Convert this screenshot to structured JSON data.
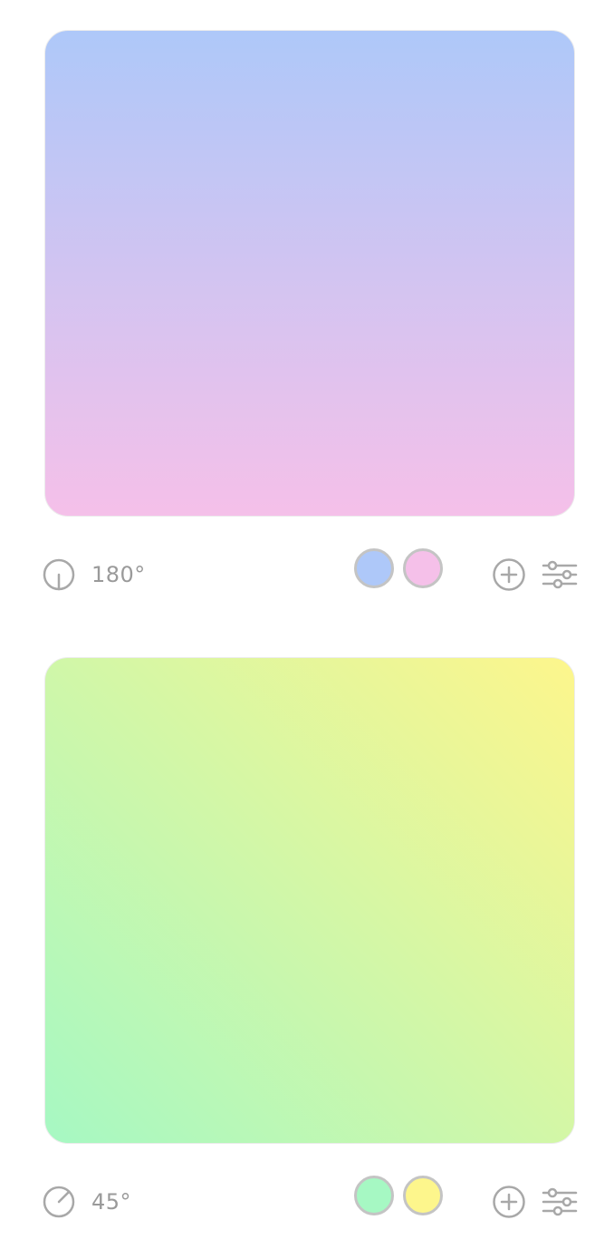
{
  "gradients": [
    {
      "angle_label": "180°",
      "angle_deg": 180,
      "colors": [
        "#aec8f9",
        "#f5c0e9"
      ],
      "stops": [
        {
          "name": "color-stop-blue",
          "color": "#aec8f9"
        },
        {
          "name": "color-stop-pink",
          "color": "#f5c0e9"
        }
      ]
    },
    {
      "angle_label": "45°",
      "angle_deg": 45,
      "colors": [
        "#a6f8c3",
        "#fdf68c"
      ],
      "stops": [
        {
          "name": "color-stop-green",
          "color": "#a6f8c3"
        },
        {
          "name": "color-stop-yellow",
          "color": "#fdf68c"
        }
      ]
    }
  ],
  "icons": {
    "angle": "angle-dial-icon",
    "add": "plus-circle-icon",
    "settings": "sliders-icon"
  },
  "ui_colors": {
    "icon_stroke": "#a8a8a8",
    "label_text": "#9a9a9a",
    "swatch_border": "#ececec"
  }
}
